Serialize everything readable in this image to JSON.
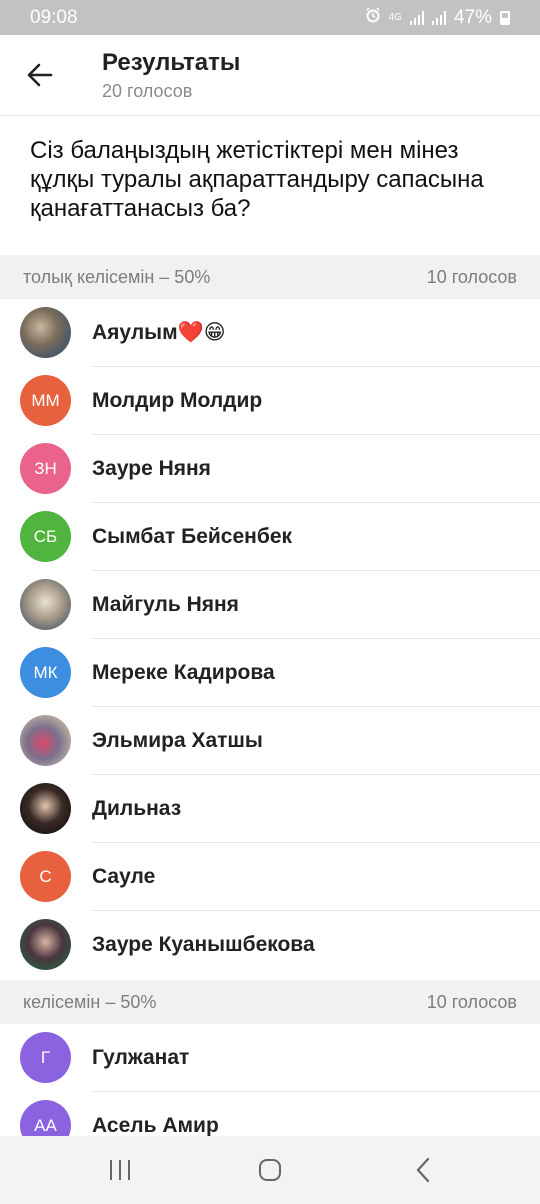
{
  "status_bar": {
    "time": "09:08",
    "battery": "47%",
    "network": "4G"
  },
  "header": {
    "title": "Результаты",
    "subtitle": "20 голосов"
  },
  "question": "Сіз балаңыздың жетістіктері мен мінез құлқы туралы ақпараттандыру сапасына қанағаттанасыз ба?",
  "sections": [
    {
      "label": "толық келісемін – 50%",
      "votes": "10 голосов",
      "voters": [
        {
          "name": "Аяулым❤️😁",
          "avatar": "photo"
        },
        {
          "name": "Молдир Молдир",
          "initials": "ММ",
          "color": "#e8613f"
        },
        {
          "name": "Зауре Няня",
          "initials": "ЗН",
          "color": "#e9638b"
        },
        {
          "name": "Сымбат Бейсенбек",
          "initials": "СБ",
          "color": "#50b53f"
        },
        {
          "name": "Майгуль Няня",
          "avatar": "photo"
        },
        {
          "name": "Мереке Кадирова",
          "initials": "МК",
          "color": "#3d8ee0"
        },
        {
          "name": "Эльмира Хатшы",
          "avatar": "photo"
        },
        {
          "name": "Дильназ",
          "avatar": "photo"
        },
        {
          "name": "Сауле",
          "initials": "С",
          "color": "#e8613f"
        },
        {
          "name": "Зауре Куанышбекова",
          "avatar": "photo"
        }
      ]
    },
    {
      "label": "келісемін – 50%",
      "votes": "10 голосов",
      "voters": [
        {
          "name": "Гулжанат",
          "initials": "Г",
          "color": "#8b63e0"
        },
        {
          "name": "Асель Амир",
          "initials": "АА",
          "color": "#8b63e0"
        }
      ]
    }
  ],
  "icons": {
    "back": "arrow-left-icon",
    "nav_recent": "recent-apps-icon",
    "nav_home": "home-icon",
    "nav_back": "chevron-left-icon"
  }
}
